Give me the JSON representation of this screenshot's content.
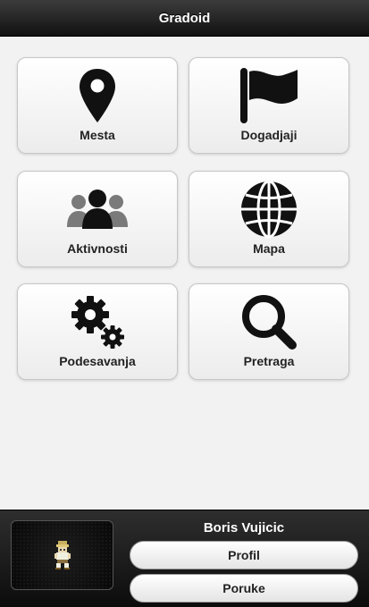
{
  "header": {
    "title": "Gradoid"
  },
  "menu": {
    "items": [
      {
        "label": "Mesta",
        "icon": "map-pin-icon"
      },
      {
        "label": "Dogadjaji",
        "icon": "flag-icon"
      },
      {
        "label": "Aktivnosti",
        "icon": "people-icon"
      },
      {
        "label": "Mapa",
        "icon": "globe-icon"
      },
      {
        "label": "Podesavanja",
        "icon": "gears-icon"
      },
      {
        "label": "Pretraga",
        "icon": "search-icon"
      }
    ]
  },
  "user": {
    "name": "Boris Vujicic",
    "profile_label": "Profil",
    "messages_label": "Poruke"
  },
  "colors": {
    "header_bg": "#1e1e1e",
    "footer_bg": "#141414",
    "content_bg": "#f2f2f2",
    "icon": "#111111"
  }
}
